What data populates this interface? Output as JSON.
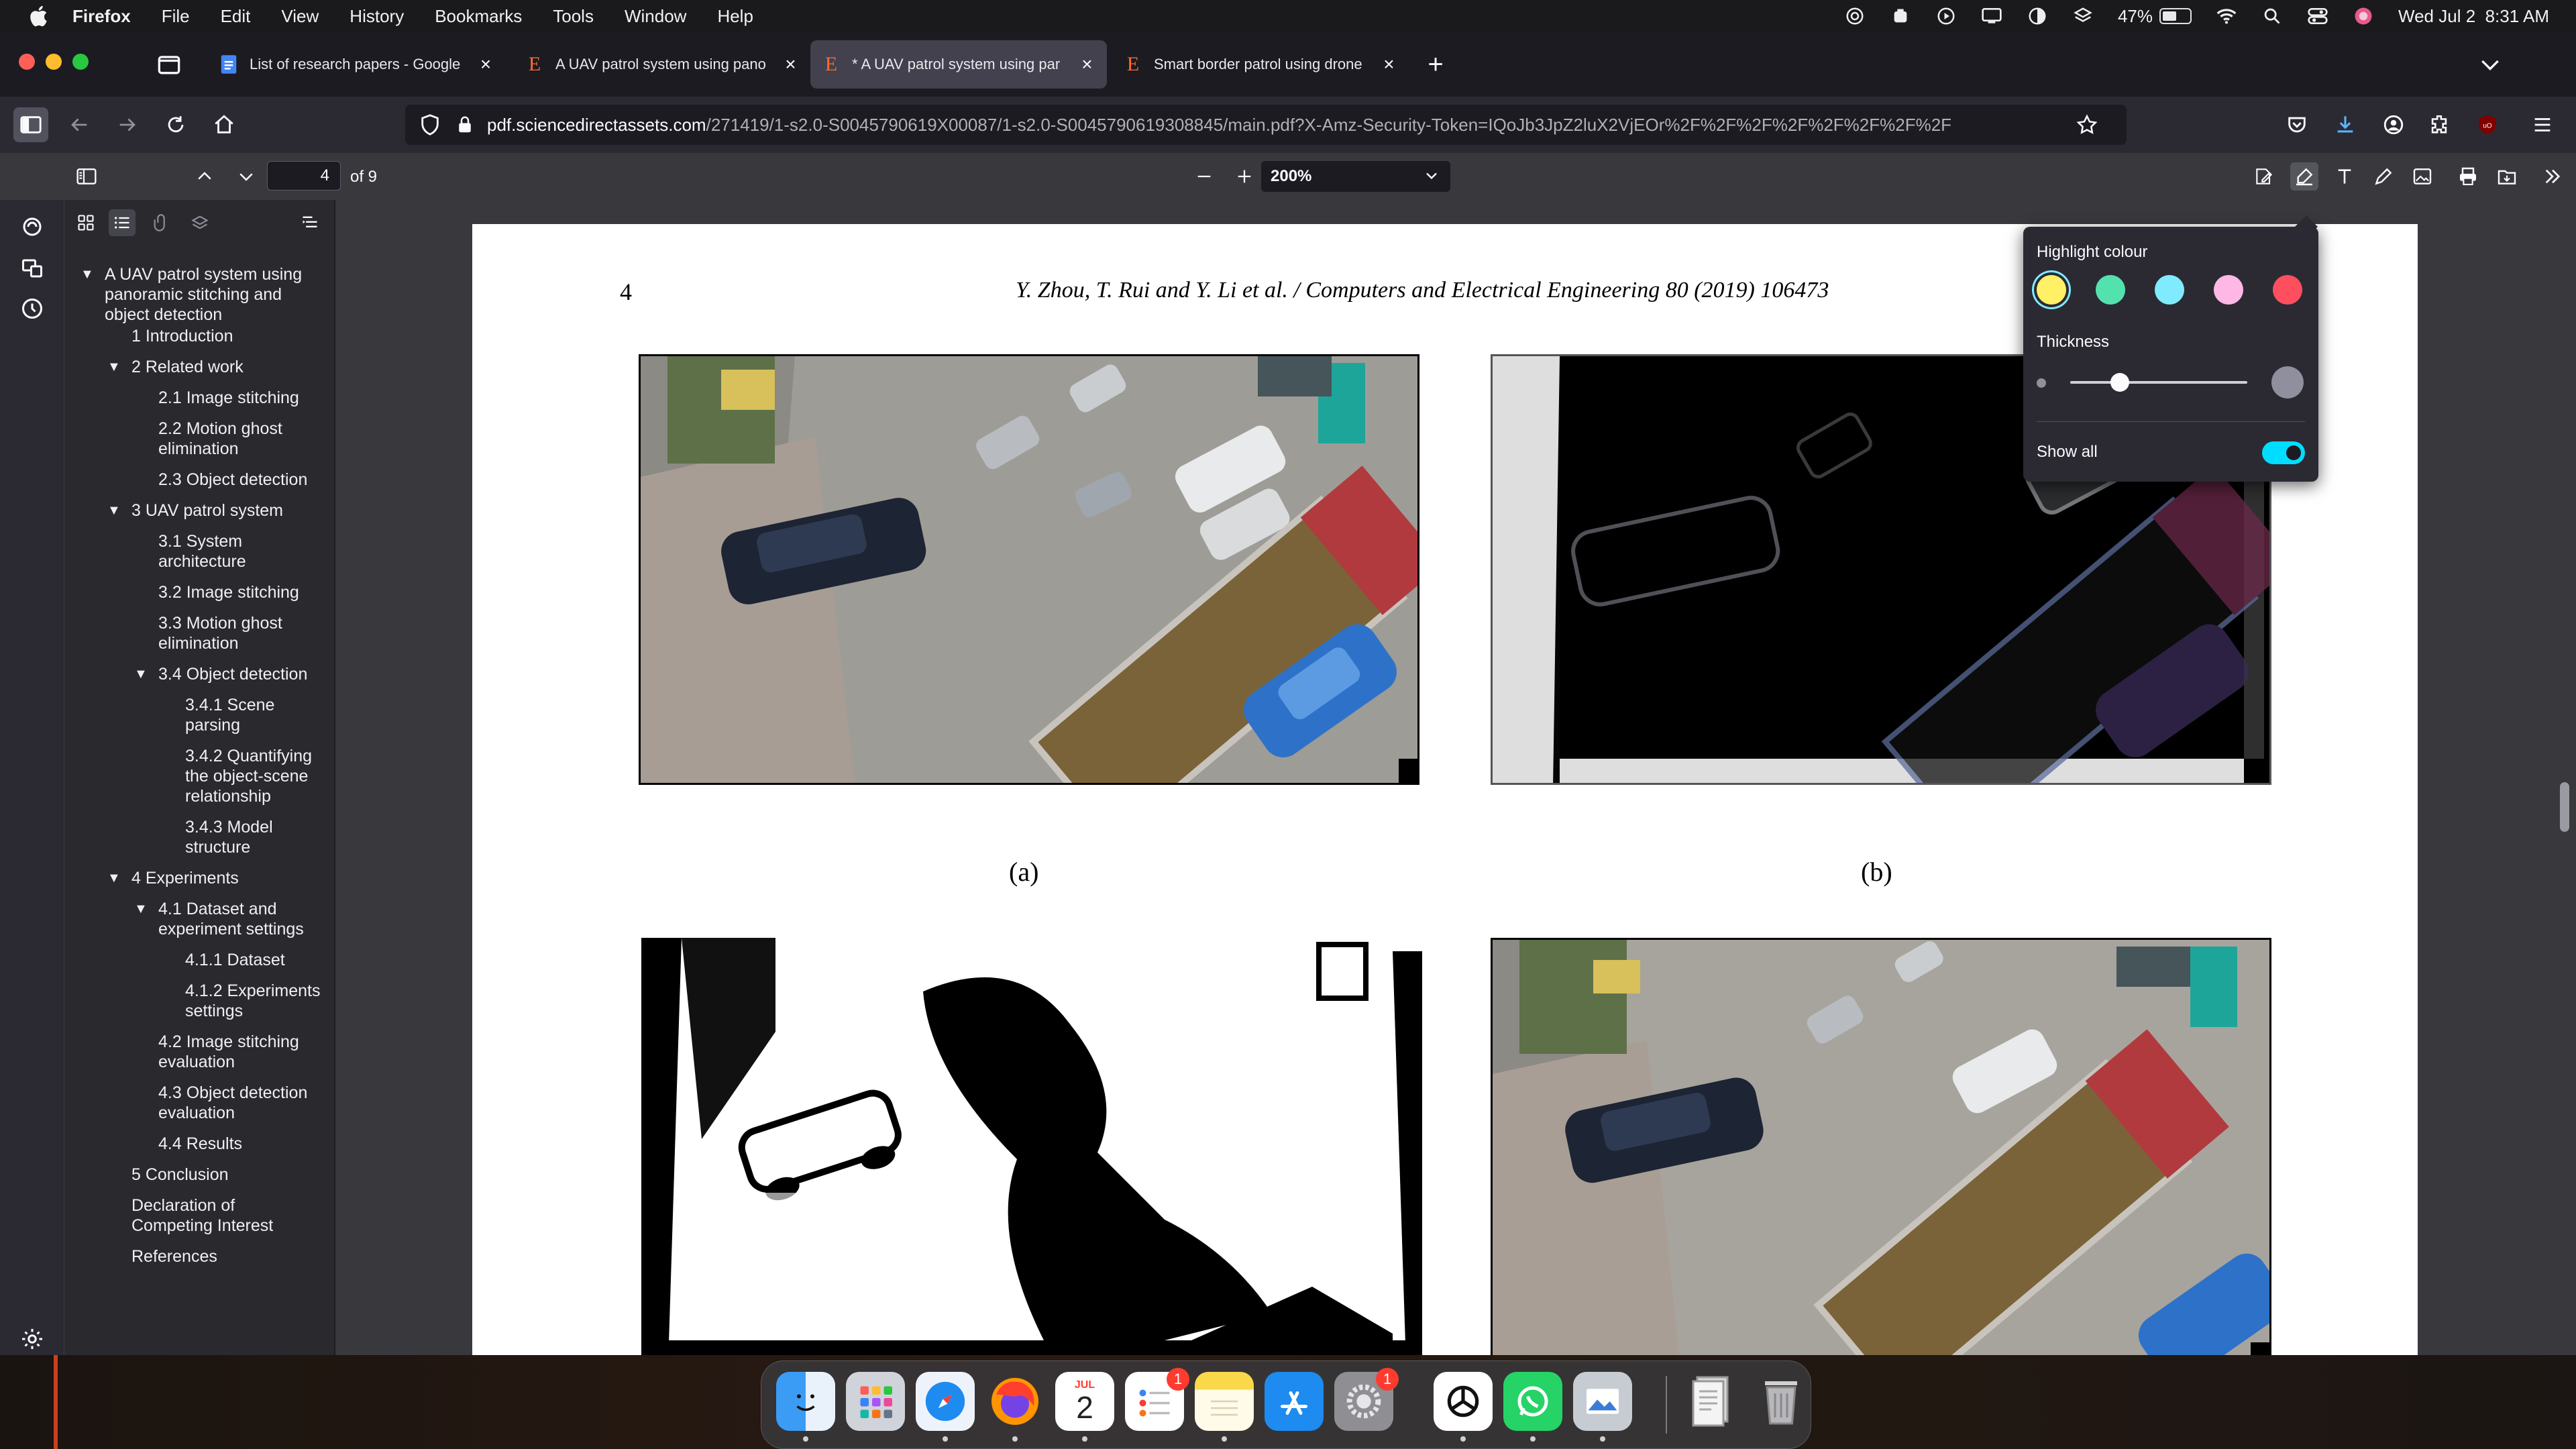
{
  "menubar": {
    "app_name": "Firefox",
    "items": [
      "File",
      "Edit",
      "View",
      "History",
      "Bookmarks",
      "Tools",
      "Window",
      "Help"
    ],
    "battery_percent": "47%",
    "battery_level": 0.47,
    "datetime": "Wed Jul 2  8:31 AM"
  },
  "tabs": [
    {
      "title": "List of research papers - Google",
      "icon": "google-docs-icon",
      "active": false
    },
    {
      "title": "A UAV patrol system using pano",
      "icon": "elsevier-icon",
      "active": false
    },
    {
      "title": "* A UAV patrol system using par",
      "icon": "elsevier-icon",
      "active": true
    },
    {
      "title": "Smart border patrol using drone",
      "icon": "elsevier-icon",
      "active": false
    }
  ],
  "urlbar": {
    "host": "pdf.sciencedirectassets.com",
    "path": "/271419/1-s2.0-S0045790619X00087/1-s2.0-S0045790619308845/main.pdf?X-Amz-Security-Token=IQoJb3JpZ2luX2VjEOr%2F%2F%2F%2F%2F%2F%2F%2F"
  },
  "pdf_toolbar": {
    "page_number": "4",
    "page_count": "of 9",
    "zoom": "200%"
  },
  "outline": [
    {
      "label": "A UAV patrol system using panoramic stitching and object detection",
      "level": 0,
      "expanded": true
    },
    {
      "label": "1 Introduction",
      "level": 1
    },
    {
      "label": "2 Related work",
      "level": 1,
      "expanded": true
    },
    {
      "label": "2.1 Image stitching",
      "level": 2
    },
    {
      "label": "2.2 Motion ghost elimination",
      "level": 2
    },
    {
      "label": "2.3 Object detection",
      "level": 2
    },
    {
      "label": "3 UAV patrol system",
      "level": 1,
      "expanded": true
    },
    {
      "label": "3.1 System architecture",
      "level": 2
    },
    {
      "label": "3.2 Image stitching",
      "level": 2
    },
    {
      "label": "3.3 Motion ghost elimination",
      "level": 2
    },
    {
      "label": "3.4 Object detection",
      "level": 2,
      "expanded": true
    },
    {
      "label": "3.4.1 Scene parsing",
      "level": 3
    },
    {
      "label": "3.4.2 Quantifying the object-scene relationship",
      "level": 3
    },
    {
      "label": "3.4.3 Model structure",
      "level": 3
    },
    {
      "label": "4 Experiments",
      "level": 1,
      "expanded": true
    },
    {
      "label": "4.1 Dataset and experiment settings",
      "level": 2,
      "expanded": true
    },
    {
      "label": "4.1.1 Dataset",
      "level": 3
    },
    {
      "label": "4.1.2 Experiments settings",
      "level": 3
    },
    {
      "label": "4.2 Image stitching evaluation",
      "level": 2
    },
    {
      "label": "4.3 Object detection evaluation",
      "level": 2
    },
    {
      "label": "4.4 Results",
      "level": 2
    },
    {
      "label": "5 Conclusion",
      "level": 1
    },
    {
      "label": "Declaration of Competing Interest",
      "level": 1
    },
    {
      "label": "References",
      "level": 1
    }
  ],
  "page": {
    "number": "4",
    "running_head": "Y. Zhou, T. Rui and Y. Li et al. / Computers and Electrical Engineering 80 (2019) 106473",
    "captions": [
      "(a)",
      "(b)"
    ]
  },
  "highlight_popup": {
    "title": "Highlight colour",
    "colors": [
      "#fff066",
      "#53e2ae",
      "#80ebff",
      "#ffb8e6",
      "#ff4f5e"
    ],
    "selected_color": 0,
    "thickness_label": "Thickness",
    "thickness_level": 0.28,
    "show_all_label": "Show all",
    "show_all_on": true
  },
  "dock": {
    "apps": [
      "Finder",
      "Launchpad",
      "Safari",
      "Firefox",
      "Calendar",
      "Reminders",
      "Notes",
      "App Store",
      "System Settings",
      "ChatGPT",
      "WhatsApp",
      "Preview",
      "Documents",
      "Trash"
    ],
    "calendar_month": "JUL",
    "calendar_day": "2",
    "badges": {
      "Reminders": "1",
      "System Settings": "1"
    }
  }
}
